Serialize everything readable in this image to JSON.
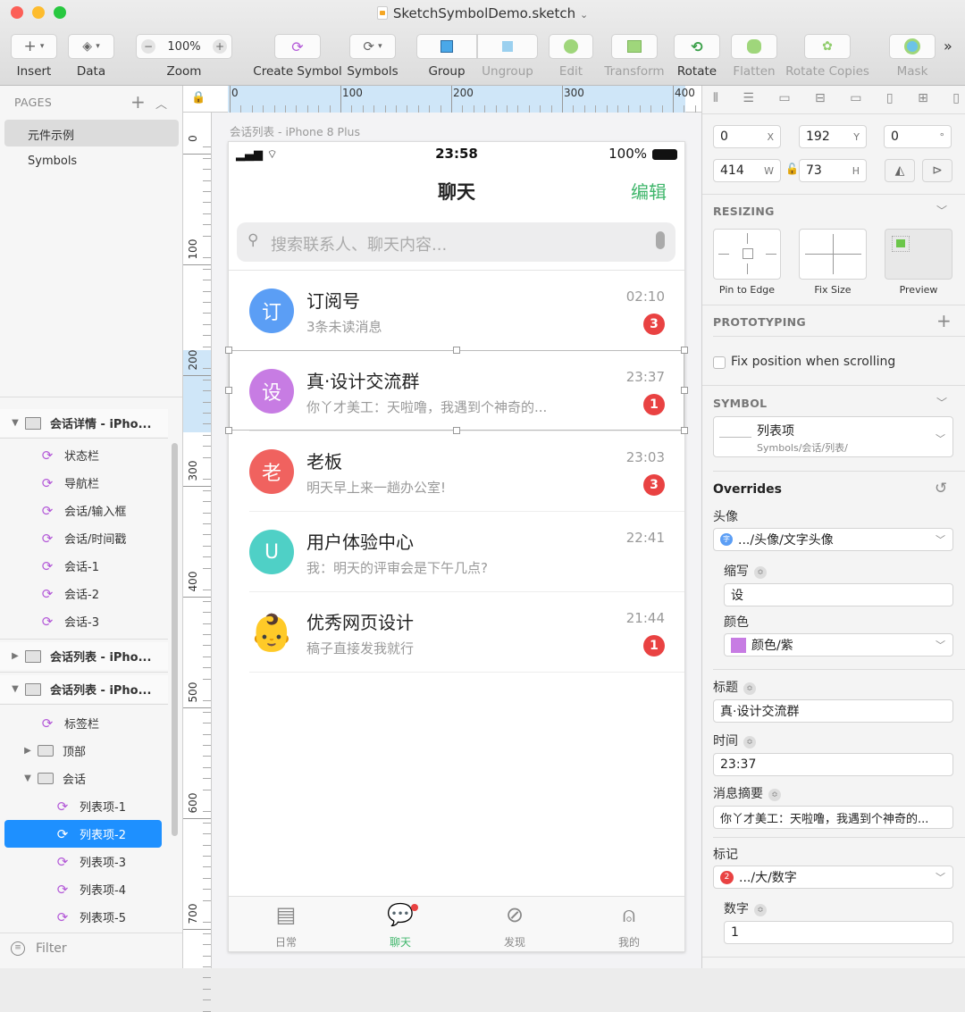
{
  "window": {
    "title": "SketchSymbolDemo.sketch",
    "title_chevron": "⌄"
  },
  "toolbar": {
    "insert": "Insert",
    "data": "Data",
    "zoom": "Zoom",
    "zoom_value": "100%",
    "create_symbol": "Create Symbol",
    "symbols": "Symbols",
    "group": "Group",
    "ungroup": "Ungroup",
    "edit": "Edit",
    "transform": "Transform",
    "rotate": "Rotate",
    "flatten": "Flatten",
    "rotate_copies": "Rotate Copies",
    "mask": "Mask",
    "more": "»"
  },
  "pages": {
    "header": "PAGES",
    "items": [
      {
        "label": "元件示例",
        "selected": true
      },
      {
        "label": "Symbols",
        "selected": false
      }
    ]
  },
  "layers": {
    "artboard1": "会话详情 - iPho...",
    "artboard1_children": [
      "状态栏",
      "导航栏",
      "会话/输入框",
      "会话/时间戳",
      "会话-1",
      "会话-2",
      "会话-3"
    ],
    "artboard2": "会话列表 - iPho...",
    "artboard3": "会话列表 - iPho...",
    "tabbar": "标签栏",
    "folder_top": "顶部",
    "folder_chat": "会话",
    "list_items": [
      "列表项-1",
      "列表项-2",
      "列表项-3",
      "列表项-4",
      "列表项-5"
    ],
    "selected_index": 1,
    "filter": "Filter"
  },
  "rulers": {
    "h_ticks": [
      "0",
      "100",
      "200",
      "300",
      "400"
    ],
    "v_ticks": [
      "0",
      "100",
      "200",
      "300",
      "400",
      "500",
      "600",
      "700"
    ]
  },
  "artboard": {
    "label": "会话列表 - iPhone 8 Plus",
    "status": {
      "time": "23:58",
      "battery": "100%"
    },
    "nav_title": "聊天",
    "nav_action": "编辑",
    "search_placeholder": "搜索联系人、聊天内容...",
    "conversations": [
      {
        "avatar": "订",
        "color": "#5b9ef5",
        "title": "订阅号",
        "subtitle": "3条未读消息",
        "time": "02:10",
        "badge": "3"
      },
      {
        "avatar": "设",
        "color": "#c77ce3",
        "title": "真·设计交流群",
        "subtitle": "你丫才美工：天啦噜，我遇到个神奇的...",
        "time": "23:37",
        "badge": "1"
      },
      {
        "avatar": "老",
        "color": "#f0625f",
        "title": "老板",
        "subtitle": "明天早上来一趟办公室!",
        "time": "23:03",
        "badge": "3"
      },
      {
        "avatar": "U",
        "color": "#4fd0c6",
        "title": "用户体验中心",
        "subtitle": "我：明天的评审会是下午几点?",
        "time": "22:41",
        "badge": ""
      },
      {
        "avatar": "👶",
        "color": "#ffffff",
        "title": "优秀网页设计",
        "subtitle": "稿子直接发我就行",
        "time": "21:44",
        "badge": "1"
      }
    ],
    "tabs": [
      {
        "label": "日常",
        "icon": "document-icon",
        "active": false
      },
      {
        "label": "聊天",
        "icon": "chat-icon",
        "active": true
      },
      {
        "label": "发现",
        "icon": "compass-icon",
        "active": false
      },
      {
        "label": "我的",
        "icon": "person-icon",
        "active": false
      }
    ],
    "accent": "#3fb66b"
  },
  "inspector": {
    "x": "0",
    "y": "192",
    "rotation": "0",
    "w": "414",
    "h": "73",
    "x_label": "X",
    "y_label": "Y",
    "rot_label": "°",
    "w_label": "W",
    "h_label": "H",
    "resizing": "RESIZING",
    "pin_to_edge": "Pin to Edge",
    "fix_size": "Fix Size",
    "preview": "Preview",
    "prototyping": "PROTOTYPING",
    "fix_position": "Fix position when scrolling",
    "symbol": "SYMBOL",
    "symbol_name": "列表项",
    "symbol_path": "Symbols/会话/列表/",
    "overrides": "Overrides",
    "avatar_label": "头像",
    "avatar_value": ".../头像/文字头像",
    "abbr_label": "缩写",
    "abbr_value": "设",
    "color_label": "颜色",
    "color_value": "颜色/紫",
    "color_swatch": "#c77ce3",
    "title_label": "标题",
    "title_value": "真·设计交流群",
    "time_label": "时间",
    "time_value": "23:37",
    "summary_label": "消息摘要",
    "summary_value": "你丫才美工：天啦噜，我遇到个神奇的...",
    "mark_label": "标记",
    "mark_value": ".../大/数字",
    "mark_badge": "2",
    "number_label": "数字",
    "number_value": "1"
  }
}
